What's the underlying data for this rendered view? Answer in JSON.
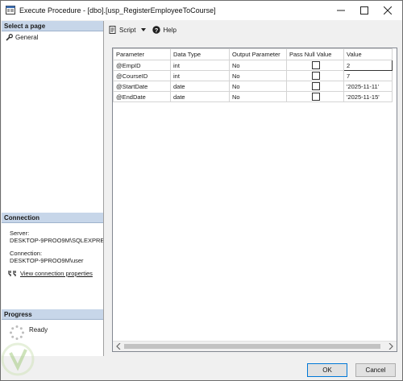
{
  "window": {
    "title": "Execute Procedure - [dbo].[usp_RegisterEmployeeToCourse]"
  },
  "left_pane": {
    "select_page_header": "Select a page",
    "pages": [
      {
        "label": "General",
        "icon": "wrench-icon"
      }
    ],
    "connection_header": "Connection",
    "server_label": "Server:",
    "server_value": "DESKTOP-9PROO9M\\SQLEXPRESS",
    "connection_label": "Connection:",
    "connection_value": "DESKTOP-9PROO9M\\user",
    "view_connection_link": "View connection properties",
    "progress_header": "Progress",
    "progress_status": "Ready"
  },
  "toolbar": {
    "script_label": "Script",
    "help_label": "Help"
  },
  "grid": {
    "columns": [
      "Parameter",
      "Data Type",
      "Output Parameter",
      "Pass Null Value",
      "Value"
    ],
    "rows": [
      {
        "parameter": "@EmpID",
        "data_type": "int",
        "output": "No",
        "pass_null": false,
        "value": "2"
      },
      {
        "parameter": "@CourseID",
        "data_type": "int",
        "output": "No",
        "pass_null": false,
        "value": "7"
      },
      {
        "parameter": "@StartDate",
        "data_type": "date",
        "output": "No",
        "pass_null": false,
        "value": "'2025-11-11'"
      },
      {
        "parameter": "@EndDate",
        "data_type": "date",
        "output": "No",
        "pass_null": false,
        "value": "'2025-11-15'"
      }
    ]
  },
  "footer": {
    "ok_label": "OK",
    "cancel_label": "Cancel"
  },
  "colors": {
    "section_header_bg": "#c7d6e9",
    "default_button_border": "#0078d7"
  }
}
